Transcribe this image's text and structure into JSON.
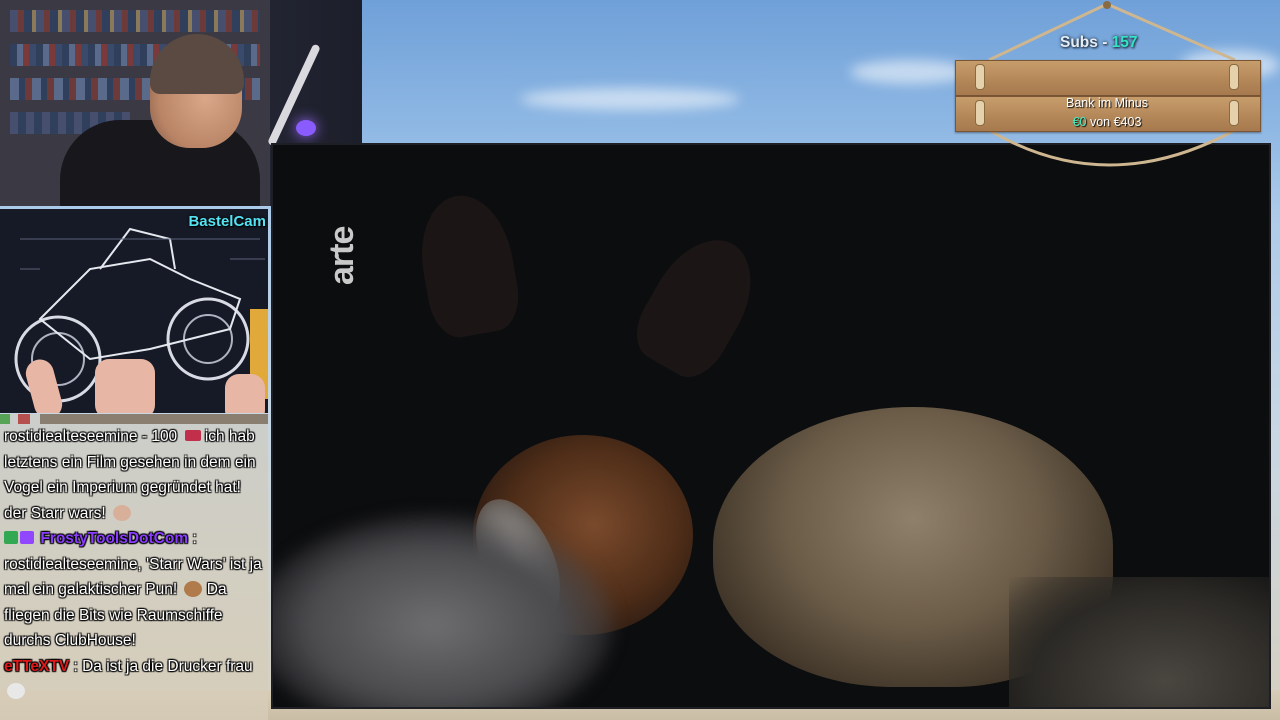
{
  "facecam": {},
  "bastelcam": {
    "label": "BastelCam"
  },
  "chat": {
    "messages": [
      {
        "user": "",
        "text": "rostidiealteseemine - 100",
        "text2": " ich hab letztens ein Film gesehen in dem ein Vogel ein Imperium gegründet hat! der Starr wars!"
      },
      {
        "user": "FrostyToolsDotCom",
        "sep": " :",
        "text": " rostidiealteseemine, 'Starr Wars' ist ja mal ein galaktischer Pun!",
        "text2": " Da fliegen die Bits wie Raumschiffe durchs ClubHouse!"
      },
      {
        "user": "eTTeXTV",
        "sep": " :",
        "text": " Da ist ja die Drucker frau"
      }
    ]
  },
  "video": {
    "channel_logo": "arte"
  },
  "sign": {
    "subs_label": "Subs - ",
    "subs_count": "157",
    "bank_label": "Bank im Minus",
    "bank_current": "€0",
    "bank_of": " von ",
    "bank_target": "€403"
  }
}
